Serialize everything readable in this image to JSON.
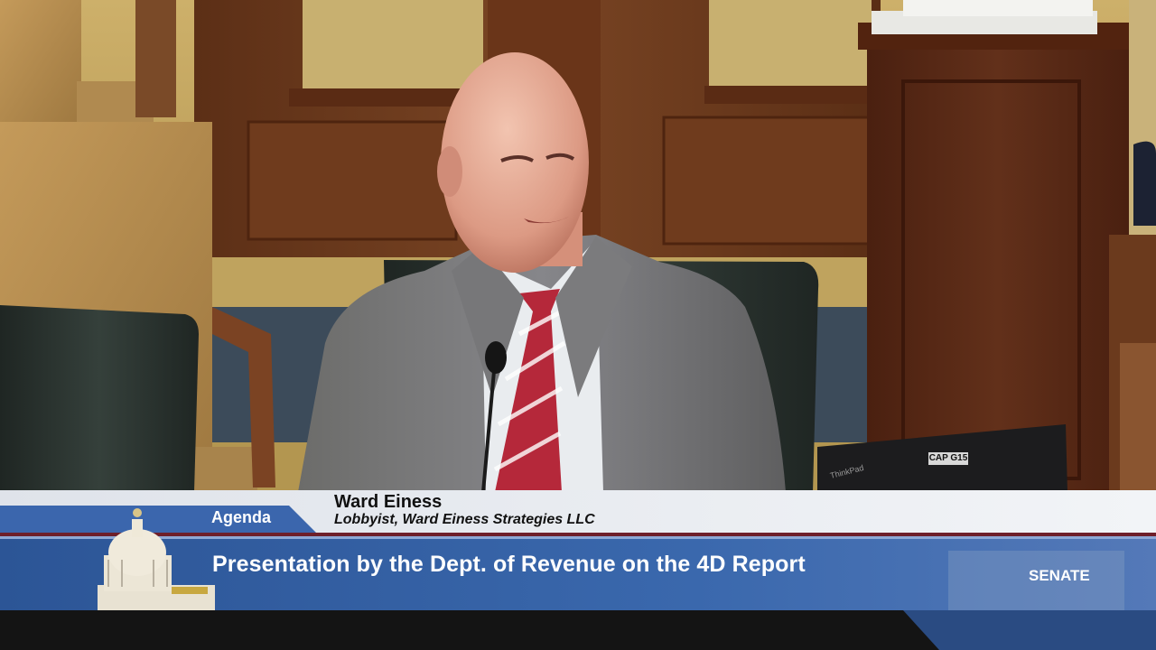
{
  "lower_third": {
    "speaker_name": "Ward Einess",
    "speaker_title": "Lobbyist, Ward Einess Strategies LLC",
    "section_label": "Agenda",
    "agenda_topic": "Presentation by the Dept. of Revenue on the 4D Report",
    "chamber_label": "SENATE"
  },
  "scene": {
    "laptop_sticker": "CAP G15"
  },
  "colors": {
    "bar_blue": "#2f5a9c",
    "bar_light": "#e9ecf1",
    "agenda_tab": "#3b66ad",
    "wood": "#6b3a1e",
    "wall": "#c9a866"
  }
}
